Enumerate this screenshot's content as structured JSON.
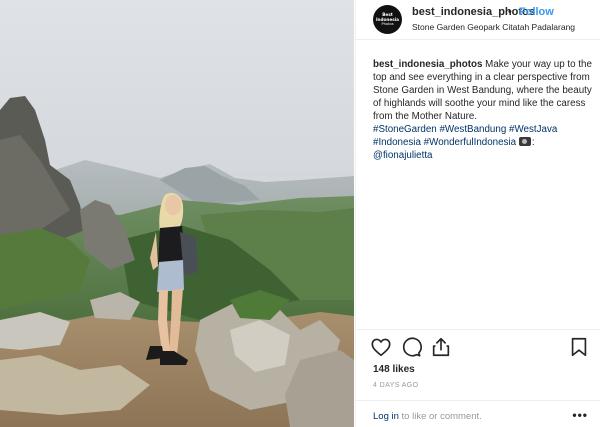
{
  "post": {
    "username": "best_indonesia_photos",
    "separator": "•",
    "follow_label": "Follow",
    "location": "Stone Garden Geopark Citatah Padalarang",
    "avatar_text": [
      "Best",
      "Indonesia",
      "Photos"
    ]
  },
  "caption": {
    "username": "best_indonesia_photos",
    "text": "Make your way up to the top and see everything in a clear perspective from Stone Garden in West Bandung, where the beauty of highlands will soothe your mind like the caress from the Mother Nature.",
    "hashtags": [
      "#StoneGarden",
      "#WestBandung",
      "#WestJava",
      "#Indonesia",
      "#WonderfulIndonesia"
    ],
    "after_emoji": ":",
    "mention": "@fionajulietta"
  },
  "stats": {
    "likes": "148 likes",
    "time": "4 DAYS AGO"
  },
  "footer": {
    "login_label": "Log in",
    "rest": " to like or comment.",
    "more_label": "•••"
  },
  "icons": {
    "like": "heart-icon",
    "comment": "comment-icon",
    "share": "share-icon",
    "save": "bookmark-icon",
    "emoji": "camera-emoji"
  },
  "colors": {
    "link": "#003569",
    "follow": "#3897f0",
    "muted": "#999999",
    "text": "#262626"
  }
}
